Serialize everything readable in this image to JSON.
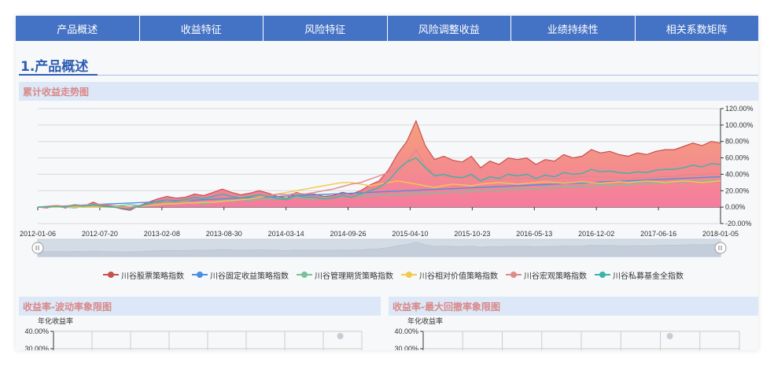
{
  "tabs": [
    "产品概述",
    "收益特征",
    "风险特征",
    "风险调整收益",
    "业绩持续性",
    "相关系数矩阵"
  ],
  "section_title": "1.产品概述",
  "main_chart_title": "累计收益走势图",
  "sub_charts": [
    {
      "title": "收益率-波动率象限图",
      "ylabel": "年化收益率",
      "yticks": [
        "40.00%",
        "30.00%"
      ]
    },
    {
      "title": "收益率-最大回撤率象限图",
      "ylabel": "年化收益率",
      "yticks": [
        "40.00%",
        "30.00%"
      ]
    }
  ],
  "colors": {
    "tab_bg": "#4472c4",
    "accent": "#2e5db3",
    "head_bg": "#dce8f7",
    "head_text": "#d98888",
    "area_top": "#f4a07a",
    "area_bottom": "#f47aa0"
  },
  "chart_data": {
    "type": "area",
    "x": [
      "2012-01-06",
      "2012-07-20",
      "2013-02-08",
      "2013-08-30",
      "2014-03-14",
      "2014-09-26",
      "2015-04-10",
      "2015-10-23",
      "2016-05-13",
      "2016-12-02",
      "2017-06-16",
      "2018-01-05"
    ],
    "y_axis": {
      "position": "right",
      "ticks": [
        "120.00%",
        "100.00%",
        "80.00%",
        "60.00%",
        "40.00%",
        "20.00%",
        "0.00%",
        "-20.00%"
      ],
      "range": [
        -20,
        120
      ]
    },
    "series": [
      {
        "name": "川谷股票策略指数",
        "color": "#c94f4f",
        "fill": true,
        "values": [
          0,
          -1,
          2,
          -1,
          3,
          1,
          6,
          2,
          1,
          -2,
          -4,
          2,
          6,
          10,
          13,
          11,
          12,
          16,
          14,
          18,
          22,
          18,
          15,
          17,
          20,
          17,
          13,
          11,
          18,
          15,
          16,
          13,
          14,
          18,
          16,
          20,
          27,
          32,
          45,
          65,
          80,
          105,
          75,
          58,
          62,
          57,
          55,
          62,
          48,
          56,
          52,
          60,
          58,
          60,
          52,
          58,
          56,
          64,
          60,
          62,
          70,
          66,
          68,
          64,
          62,
          66,
          64,
          68,
          70,
          70,
          74,
          78,
          75,
          80,
          78
        ]
      },
      {
        "name": "川谷固定收益策略指数",
        "color": "#4a90e2",
        "fill": false,
        "values": [
          0,
          0.5,
          1,
          1.5,
          2,
          2.5,
          3,
          3.5,
          4,
          4.5,
          5,
          5.5,
          6,
          6.5,
          7,
          7.5,
          8,
          8.5,
          9,
          9.5,
          10,
          10.5,
          11,
          11.5,
          12,
          12.5,
          13,
          13.5,
          14,
          14.5,
          15,
          15.5,
          16,
          16.5,
          17,
          17.5,
          18,
          18.5,
          19,
          19.5,
          20,
          20.5,
          21,
          21.5,
          22,
          22.5,
          23,
          23.5,
          24,
          24.5,
          25,
          25.5,
          26,
          26.5,
          27,
          27.5,
          28,
          28.5,
          29,
          29.5,
          30,
          30.5,
          31,
          31.5,
          32,
          32.5,
          33,
          33.5,
          34,
          34.5,
          35,
          35.5,
          36,
          36.5,
          37
        ]
      },
      {
        "name": "川谷管理期货策略指数",
        "color": "#7ac29a",
        "fill": false,
        "values": [
          0,
          0,
          1,
          0,
          -1,
          1,
          2,
          1,
          0,
          2,
          3,
          2,
          4,
          3,
          5,
          4,
          6,
          5,
          4,
          6,
          8,
          7,
          9,
          8,
          10,
          9,
          11,
          10,
          12,
          11,
          10,
          12,
          11,
          13,
          12,
          14,
          13,
          15,
          14,
          16,
          15,
          17,
          16,
          18,
          17,
          19,
          18,
          20,
          19,
          21,
          20,
          22,
          21,
          23,
          22,
          24,
          23,
          25,
          24,
          26,
          25,
          27,
          26,
          28,
          27,
          29,
          28,
          30,
          29,
          31,
          30,
          32,
          31,
          33,
          32
        ]
      },
      {
        "name": "川谷相对价值策略指数",
        "color": "#f2c94c",
        "fill": false,
        "values": [
          0,
          0,
          0,
          0,
          0,
          0,
          0,
          0,
          0,
          0,
          0,
          1,
          2,
          3,
          4,
          4,
          5,
          5,
          6,
          6,
          7,
          8,
          9,
          10,
          12,
          14,
          16,
          18,
          20,
          22,
          24,
          26,
          28,
          30,
          30,
          28,
          26,
          28,
          30,
          32,
          30,
          28,
          26,
          24,
          26,
          28,
          27,
          26,
          28,
          29,
          30,
          29,
          28,
          29,
          30,
          31,
          30,
          29,
          30,
          31,
          30,
          29,
          30,
          31,
          30,
          31,
          32,
          31,
          30,
          31,
          32,
          31,
          30,
          31,
          32
        ]
      },
      {
        "name": "川谷宏观策略指数",
        "color": "#e08a8a",
        "fill": false,
        "values": [
          0,
          1,
          2,
          1,
          3,
          2,
          4,
          3,
          2,
          1,
          0,
          2,
          3,
          5,
          7,
          6,
          8,
          10,
          12,
          11,
          13,
          12,
          14,
          13,
          15,
          14,
          16,
          15,
          17,
          16,
          18,
          20,
          22,
          25,
          28,
          30,
          34,
          38,
          42,
          48,
          55,
          70,
          50,
          40,
          38,
          36,
          35,
          38,
          32,
          34,
          33,
          35,
          34,
          36,
          33,
          35,
          34,
          36,
          35,
          37,
          38,
          36,
          37,
          35,
          34,
          36,
          35,
          37,
          38,
          37,
          39,
          40,
          39,
          41,
          40
        ]
      },
      {
        "name": "川谷私募基金全指数",
        "color": "#3cb4a8",
        "fill": false,
        "values": [
          0,
          0,
          1,
          0,
          2,
          1,
          3,
          1,
          0,
          -1,
          -2,
          1,
          4,
          7,
          9,
          8,
          9,
          12,
          10,
          13,
          16,
          13,
          11,
          13,
          15,
          13,
          10,
          9,
          14,
          12,
          12,
          10,
          11,
          14,
          12,
          16,
          20,
          24,
          32,
          45,
          55,
          60,
          48,
          38,
          40,
          37,
          36,
          40,
          32,
          37,
          35,
          40,
          38,
          40,
          35,
          39,
          37,
          42,
          40,
          41,
          46,
          43,
          44,
          42,
          41,
          43,
          42,
          45,
          46,
          46,
          48,
          51,
          49,
          53,
          52
        ]
      }
    ],
    "legend": "bottom",
    "grid": true,
    "datazoom": true
  }
}
